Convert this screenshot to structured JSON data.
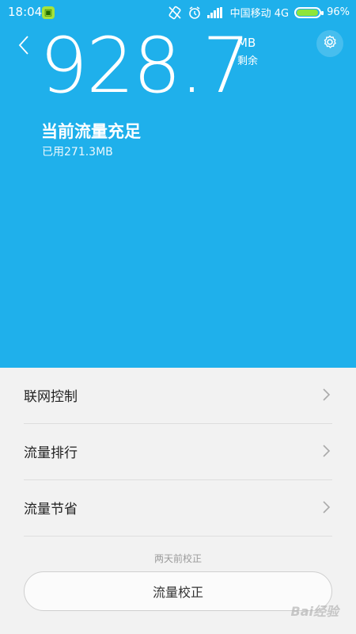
{
  "status_bar": {
    "time": "18:04",
    "carrier": "中国移动 4G",
    "battery_percent": "96%",
    "battery_level": 0.96
  },
  "hero": {
    "remaining_value": "928.7",
    "unit": "MB",
    "remaining_label": "剩余",
    "status_title": "当前流量充足",
    "used_text": "已用271.3MB"
  },
  "menu": {
    "items": [
      {
        "label": "联网控制"
      },
      {
        "label": "流量排行"
      },
      {
        "label": "流量节省"
      }
    ]
  },
  "footer": {
    "hint": "两天前校正",
    "calibrate_label": "流量校正"
  },
  "colors": {
    "accent": "#1fb0eb",
    "background": "#f2f2f2"
  }
}
